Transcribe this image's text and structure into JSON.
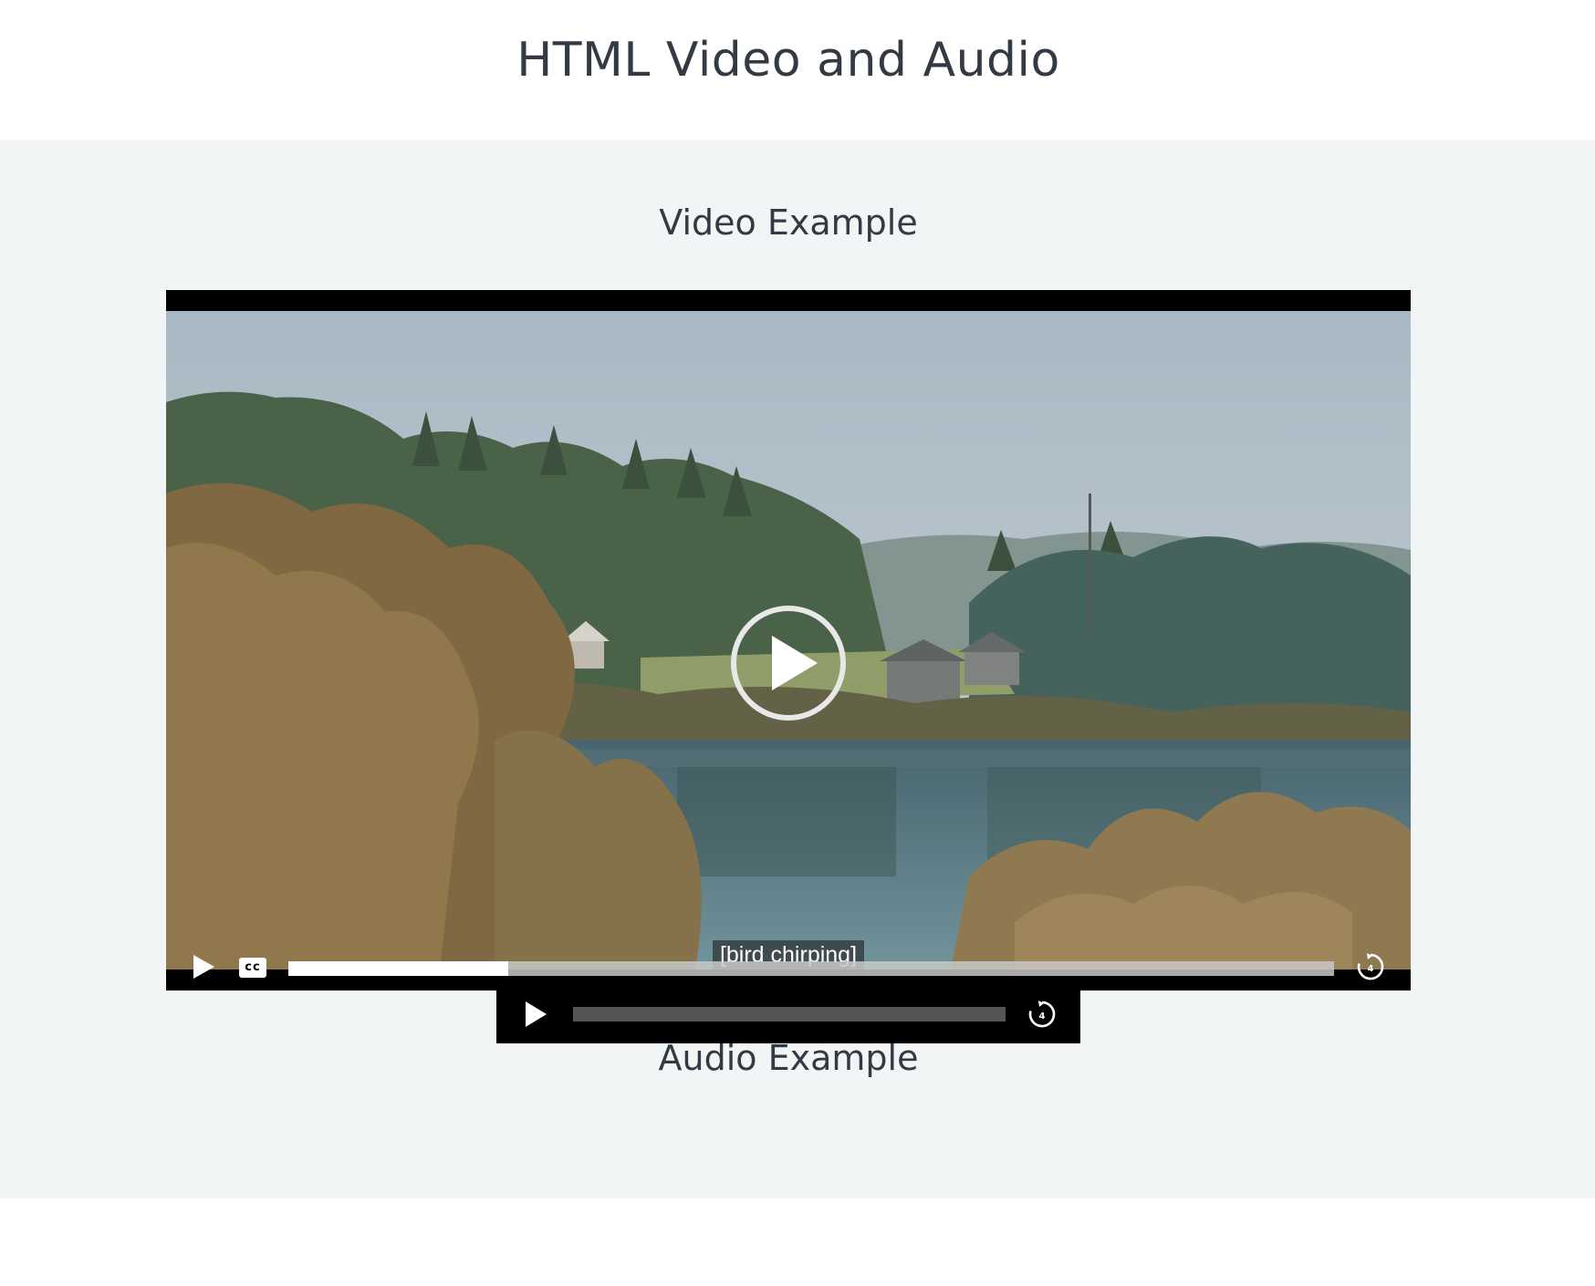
{
  "page": {
    "title": "HTML Video and Audio"
  },
  "video_section": {
    "heading": "Video Example",
    "player": {
      "caption": "[bird chirping]",
      "cc_label": "cc",
      "progress_fraction": 0.21,
      "icons": {
        "big_play": "play-circle-icon",
        "play": "play-icon",
        "captions": "closed-captions-icon",
        "replay": "replay-4-icon"
      }
    }
  },
  "audio_section": {
    "heading": "Audio Example",
    "player": {
      "progress_fraction": 0,
      "icons": {
        "play": "play-icon",
        "replay": "replay-4-icon"
      }
    }
  },
  "colors": {
    "heading_text": "#333a44",
    "section_background": "#f2f5f6",
    "player_background": "#000000",
    "progress_fill": "#ffffff"
  }
}
